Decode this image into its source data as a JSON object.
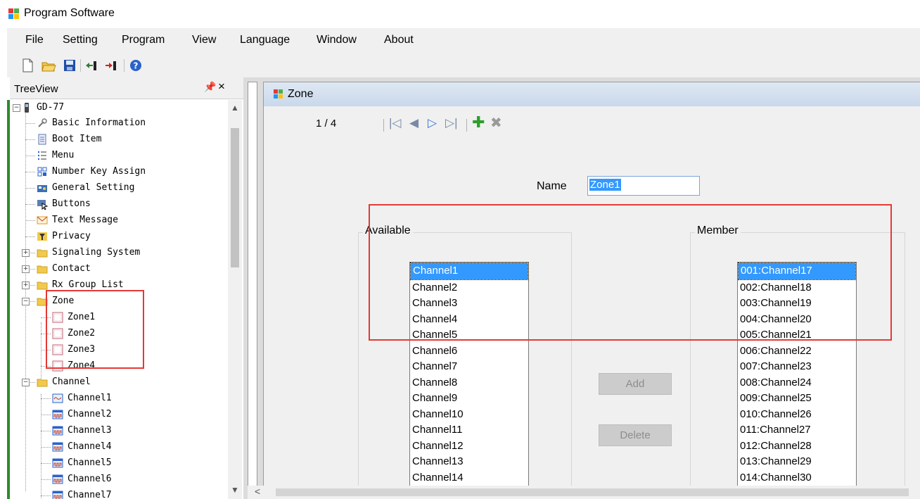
{
  "window": {
    "title": "Program Software"
  },
  "menu": [
    "File",
    "Setting",
    "Program",
    "View",
    "Language",
    "Window",
    "About"
  ],
  "toolbar": {
    "icons": [
      "new-file-icon",
      "open-folder-icon",
      "save-icon",
      "read-from-radio-icon",
      "write-to-radio-icon",
      "help-icon"
    ]
  },
  "tree_panel": {
    "title": "TreeView",
    "pin_glyph": " 1",
    "close_glyph": "×",
    "root": "GD-77",
    "items": [
      "Basic Information",
      "Boot Item",
      "Menu",
      "Number Key Assign",
      "General Setting",
      "Buttons",
      "Text Message",
      "Privacy",
      "Signaling System",
      "Contact",
      "Rx Group List",
      "Zone",
      "Zone1",
      "Zone2",
      "Zone3",
      "Zone4",
      "Channel",
      "Channel1",
      "Channel2",
      "Channel3",
      "Channel4",
      "Channel5",
      "Channel6",
      "Channel7"
    ]
  },
  "zone_window": {
    "title": "Zone",
    "record_position": "1 / 4",
    "name_label": "Name",
    "name_value": "Zone1",
    "available_label": "Available",
    "member_label": "Member",
    "available": [
      "Channel1",
      "Channel2",
      "Channel3",
      "Channel4",
      "Channel5",
      "Channel6",
      "Channel7",
      "Channel8",
      "Channel9",
      "Channel10",
      "Channel11",
      "Channel12",
      "Channel13",
      "Channel14"
    ],
    "members": [
      "001:Channel17",
      "002:Channel18",
      "003:Channel19",
      "004:Channel20",
      "005:Channel21",
      "006:Channel22",
      "007:Channel23",
      "008:Channel24",
      "009:Channel25",
      "010:Channel26",
      "011:Channel27",
      "012:Channel28",
      "013:Channel29",
      "014:Channel30"
    ],
    "add_label": "Add",
    "delete_label": "Delete"
  },
  "colors": {
    "highlight": "#3399ff",
    "annotation": "#e53935",
    "accent_strip": "#2e8b2e"
  }
}
